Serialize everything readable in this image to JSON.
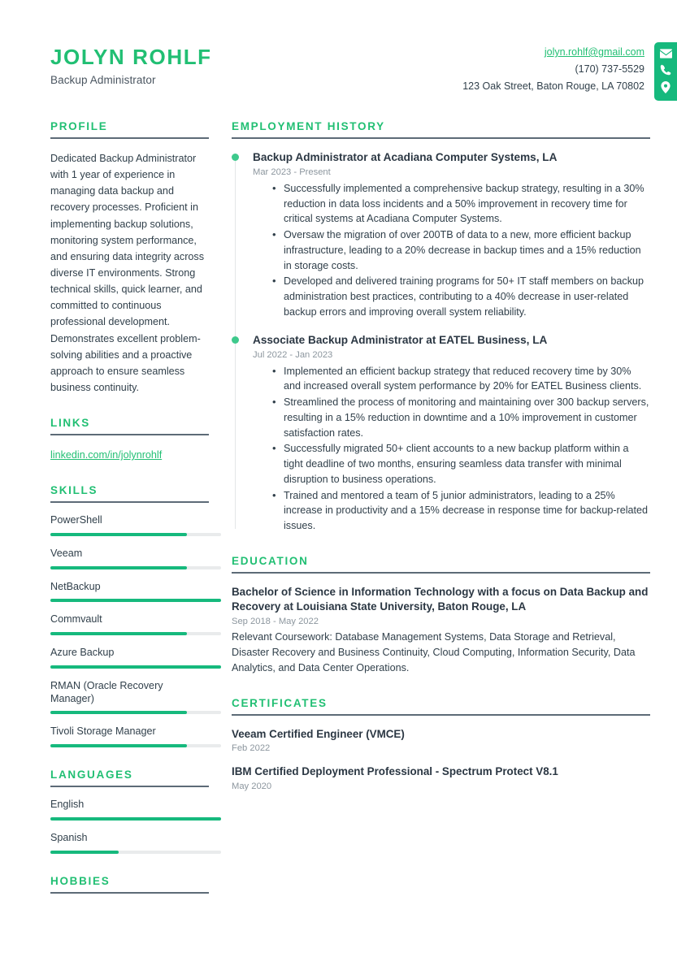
{
  "theme": {
    "accent": "#21bf73",
    "accent_bar": "#16b97d",
    "dot": "#3ec98c",
    "text": "#31404b",
    "muted": "#8c969e",
    "rule": "#5d6b77",
    "track": "#e9ebec"
  },
  "header": {
    "name": "JOLYN ROHLF",
    "job_title": "Backup Administrator",
    "contact": {
      "email": "jolyn.rohlf@gmail.com",
      "phone": "(170) 737-5529",
      "address": "123 Oak Street, Baton Rouge, LA 70802",
      "icons": [
        "envelope-icon",
        "phone-icon",
        "location-pin-icon"
      ]
    }
  },
  "left": {
    "profile": {
      "heading": "PROFILE",
      "text": "Dedicated Backup Administrator with 1 year of experience in managing data backup and recovery processes. Proficient in implementing backup solutions, monitoring system performance, and ensuring data integrity across diverse IT environments. Strong technical skills, quick learner, and committed to continuous professional development. Demonstrates excellent problem-solving abilities and a proactive approach to ensure seamless business continuity."
    },
    "links": {
      "heading": "LINKS",
      "items": [
        {
          "label": "linkedin.com/in/jolynrohlf"
        }
      ]
    },
    "skills": {
      "heading": "SKILLS",
      "items": [
        {
          "label": "PowerShell",
          "level": 80
        },
        {
          "label": "Veeam",
          "level": 80
        },
        {
          "label": "NetBackup",
          "level": 100
        },
        {
          "label": "Commvault",
          "level": 80
        },
        {
          "label": "Azure Backup",
          "level": 100
        },
        {
          "label": "RMAN (Oracle Recovery Manager)",
          "level": 80
        },
        {
          "label": "Tivoli Storage Manager",
          "level": 80
        }
      ]
    },
    "languages": {
      "heading": "LANGUAGES",
      "items": [
        {
          "label": "English",
          "level": 100
        },
        {
          "label": "Spanish",
          "level": 40
        }
      ]
    },
    "hobbies": {
      "heading": "HOBBIES",
      "items": []
    }
  },
  "right": {
    "employment": {
      "heading": "EMPLOYMENT HISTORY",
      "entries": [
        {
          "title": "Backup Administrator at Acadiana Computer Systems, LA",
          "date": "Mar 2023 - Present",
          "bullets": [
            "Successfully implemented a comprehensive backup strategy, resulting in a 30% reduction in data loss incidents and a 50% improvement in recovery time for critical systems at Acadiana Computer Systems.",
            "Oversaw the migration of over 200TB of data to a new, more efficient backup infrastructure, leading to a 20% decrease in backup times and a 15% reduction in storage costs.",
            "Developed and delivered training programs for 50+ IT staff members on backup administration best practices, contributing to a 40% decrease in user-related backup errors and improving overall system reliability."
          ]
        },
        {
          "title": "Associate Backup Administrator at EATEL Business, LA",
          "date": "Jul 2022 - Jan 2023",
          "bullets": [
            "Implemented an efficient backup strategy that reduced recovery time by 30% and increased overall system performance by 20% for EATEL Business clients.",
            "Streamlined the process of monitoring and maintaining over 300 backup servers, resulting in a 15% reduction in downtime and a 10% improvement in customer satisfaction rates.",
            "Successfully migrated 50+ client accounts to a new backup platform within a tight deadline of two months, ensuring seamless data transfer with minimal disruption to business operations.",
            "Trained and mentored a team of 5 junior administrators, leading to a 25% increase in productivity and a 15% decrease in response time for backup-related issues."
          ]
        }
      ]
    },
    "education": {
      "heading": "EDUCATION",
      "entries": [
        {
          "title": "Bachelor of Science in Information Technology with a focus on Data Backup and Recovery at Louisiana State University, Baton Rouge, LA",
          "date": "Sep 2018 - May 2022",
          "description": "Relevant Coursework: Database Management Systems, Data Storage and Retrieval, Disaster Recovery and Business Continuity, Cloud Computing, Information Security, Data Analytics, and Data Center Operations."
        }
      ]
    },
    "certificates": {
      "heading": "CERTIFICATES",
      "entries": [
        {
          "title": "Veeam Certified Engineer (VMCE)",
          "date": "Feb 2022"
        },
        {
          "title": "IBM Certified Deployment Professional - Spectrum Protect V8.1",
          "date": "May 2020"
        }
      ]
    }
  }
}
